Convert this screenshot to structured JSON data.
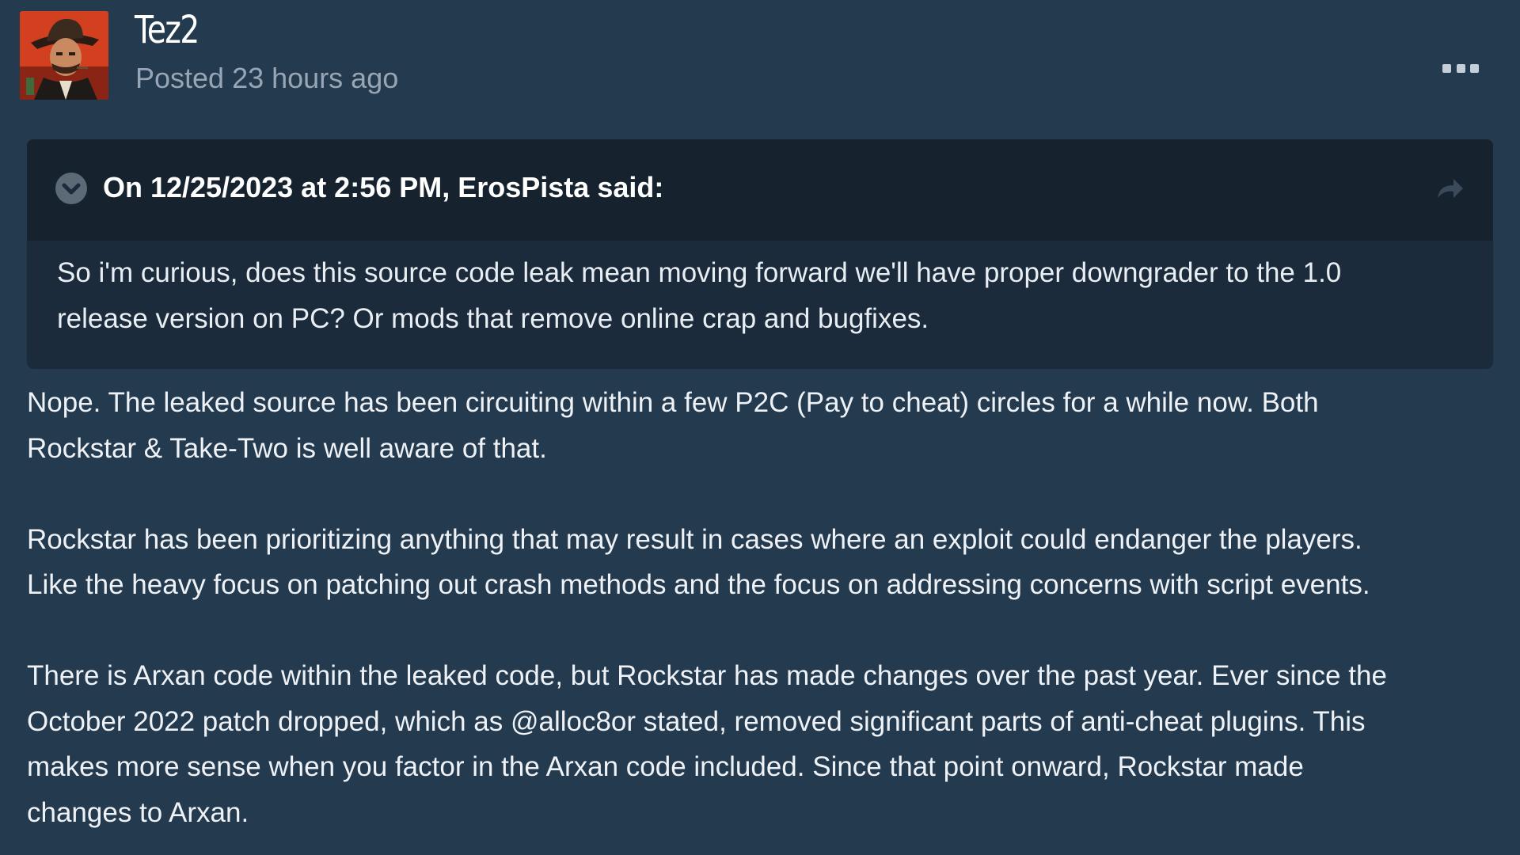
{
  "post": {
    "author": "Tez2",
    "posted": "Posted 23 hours ago",
    "avatar_icon": "cowboy-portrait-avatar",
    "more_icon": "ellipsis-icon"
  },
  "quote": {
    "citation": "On 12/25/2023 at 2:56 PM, ErosPista said:",
    "body_lines": [
      "So i'm curious, does this source code leak mean moving forward we'll have proper downgrader to the 1.0",
      "release version on PC? Or mods that remove online crap and bugfixes."
    ]
  },
  "content": {
    "paragraphs": [
      [
        "Nope. The leaked source has been circuiting within a few P2C (Pay to cheat) circles for a while now. Both",
        "Rockstar & Take-Two is well aware of that."
      ],
      [
        "Rockstar has been prioritizing anything that may result in cases where an exploit could endanger the players.",
        "Like the heavy focus on patching out crash methods and the focus on addressing concerns with script events."
      ],
      [
        "There is Arxan code within the leaked code, but Rockstar has made changes over the past year. Ever since the",
        "October 2022 patch dropped, which as @alloc8or stated, removed significant parts of anti-cheat plugins. This",
        "makes more sense when you factor in the Arxan code included. Since that point onward, Rockstar made",
        "changes to Arxan."
      ]
    ]
  },
  "colors": {
    "page_background": "#243a4f",
    "quote_background": "#1b2b3c",
    "quote_header_background": "#16232f",
    "muted_text": "#97a6b5"
  }
}
